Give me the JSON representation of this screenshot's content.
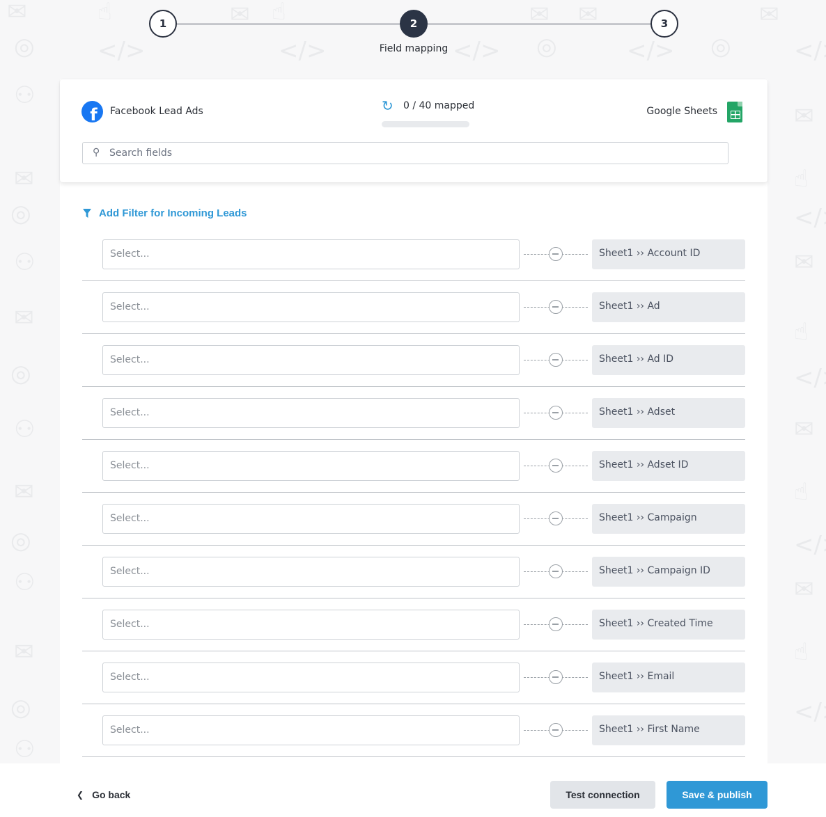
{
  "stepper": {
    "steps": [
      {
        "number": "1",
        "label": ""
      },
      {
        "number": "2",
        "label": "Field mapping"
      },
      {
        "number": "3",
        "label": ""
      }
    ],
    "active_step": 2
  },
  "header": {
    "source_name": "Facebook Lead Ads",
    "source_icon": "facebook-logo-icon",
    "destination_name": "Google Sheets",
    "destination_icon": "google-sheets-logo-icon",
    "mapped_text": "0 / 40 mapped",
    "mapped_fraction": 0,
    "search_placeholder": "Search fields"
  },
  "filter": {
    "label": "Add Filter for Incoming Leads"
  },
  "mapping": {
    "select_placeholder": "Select...",
    "rows": [
      {
        "target": "Sheet1 ›› Account ID"
      },
      {
        "target": "Sheet1 ›› Ad"
      },
      {
        "target": "Sheet1 ›› Ad ID"
      },
      {
        "target": "Sheet1 ›› Adset"
      },
      {
        "target": "Sheet1 ›› Adset ID"
      },
      {
        "target": "Sheet1 ›› Campaign"
      },
      {
        "target": "Sheet1 ›› Campaign ID"
      },
      {
        "target": "Sheet1 ›› Created Time"
      },
      {
        "target": "Sheet1 ›› Email"
      },
      {
        "target": "Sheet1 ›› First Name"
      }
    ]
  },
  "footer": {
    "go_back_label": "Go back",
    "test_label": "Test connection",
    "save_label": "Save & publish"
  },
  "colors": {
    "accent": "#2f98d6",
    "step_active": "#2b3445",
    "facebook": "#1877f2",
    "sheets": "#23a566"
  }
}
